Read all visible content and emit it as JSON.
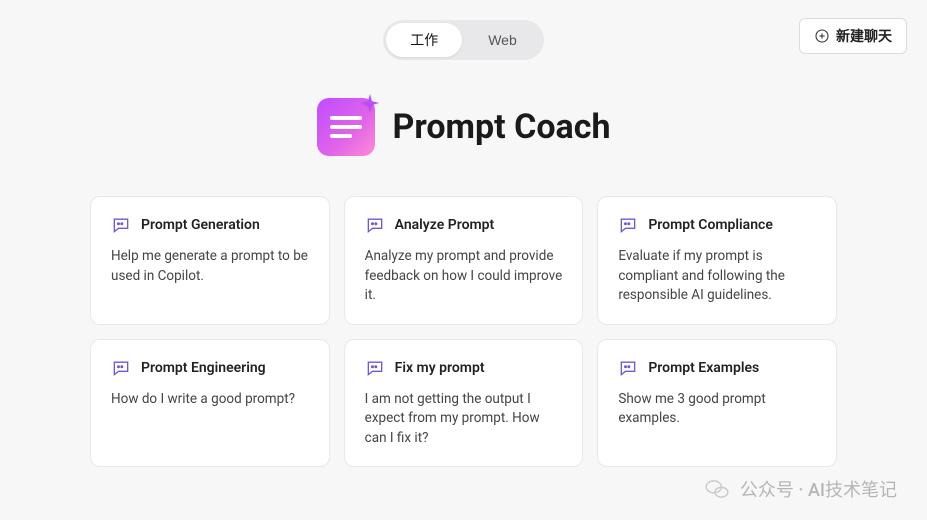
{
  "toggle": {
    "work": "工作",
    "web": "Web"
  },
  "newChat": "新建聊天",
  "title": "Prompt Coach",
  "cards": [
    {
      "title": "Prompt Generation",
      "desc": "Help me generate a prompt to be used in Copilot."
    },
    {
      "title": "Analyze Prompt",
      "desc": "Analyze my prompt and provide feedback on how I could improve it."
    },
    {
      "title": "Prompt Compliance",
      "desc": "Evaluate if my prompt is compliant and following the responsible AI guidelines."
    },
    {
      "title": "Prompt Engineering",
      "desc": "How do I write a good prompt?"
    },
    {
      "title": "Fix my prompt",
      "desc": "I am not getting the output I expect from my prompt. How can I fix it?"
    },
    {
      "title": "Prompt Examples",
      "desc": "Show me 3 good prompt examples."
    }
  ],
  "watermark": "公众号 · AI技术笔记"
}
